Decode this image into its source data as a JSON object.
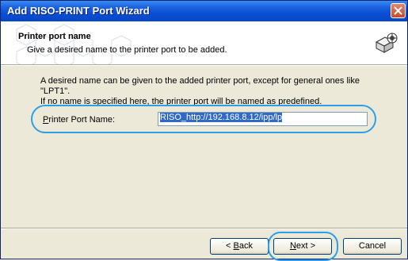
{
  "window": {
    "title": "Add RISO-PRINT Port Wizard"
  },
  "header": {
    "title": "Printer port name",
    "subtitle": "Give a desired name to the printer port to be added."
  },
  "body": {
    "description_line1": "A desired name can be given to the added printer port, except for general ones like \"LPT1\".",
    "description_line2": "If no name is specified here, the printer port will be named as predefined."
  },
  "field": {
    "label_underlined": "P",
    "label_rest": "rinter Port Name:",
    "value": "RISO_http://192.168.8.12/ipp/lp"
  },
  "buttons": {
    "back_prefix": "< ",
    "back_underlined": "B",
    "back_rest": "ack",
    "next_underlined": "N",
    "next_rest": "ext >",
    "cancel": "Cancel"
  },
  "colors": {
    "title_bar": "#0a4fd6",
    "highlight_ring": "#2aa0e8",
    "selection": "#316ac5"
  },
  "icons": [
    "close-icon",
    "printer-wizard-icon"
  ]
}
